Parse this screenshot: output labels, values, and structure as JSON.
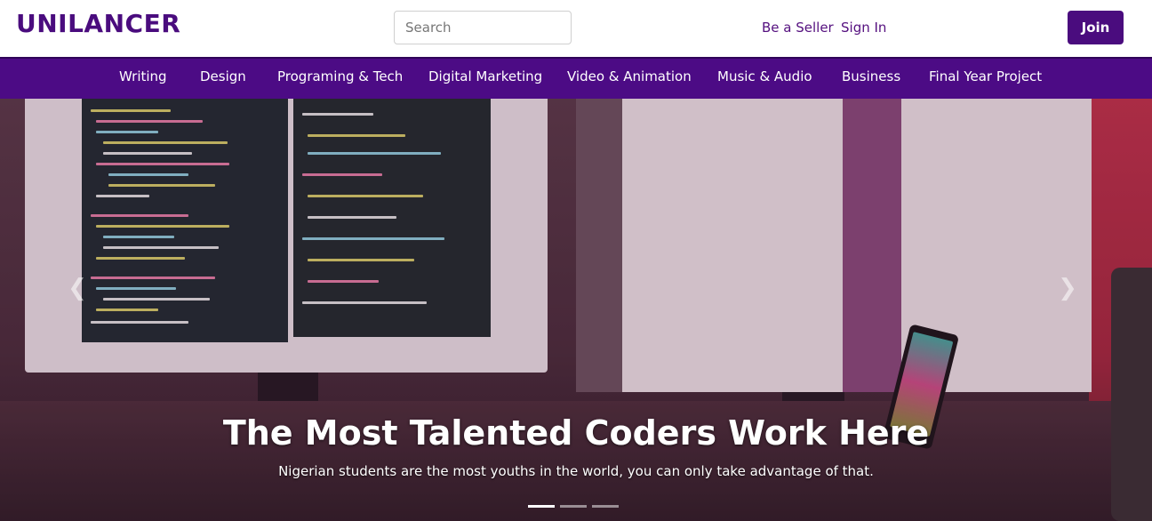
{
  "header": {
    "brand": "UNILANCER",
    "search_placeholder": "Search",
    "be_a_seller": "Be a Seller",
    "sign_in": "Sign In",
    "join": "Join"
  },
  "categories": [
    "Writing",
    "Design",
    "Programing & Tech",
    "Digital Marketing",
    "Video & Animation",
    "Music & Audio",
    "Business",
    "Final Year Project"
  ],
  "carousel": {
    "title": "The Most Talented Coders Work Here",
    "subtitle": "Nigerian students are the most youths in the world, you can only take advantage of that.",
    "prev_icon": "chevron-left-icon",
    "next_icon": "chevron-right-icon",
    "slide_count": 3,
    "active_slide": 1
  },
  "colors": {
    "brand": "#4a0c7e",
    "nav_bg": "#4c0b85",
    "link": "#55107f"
  }
}
